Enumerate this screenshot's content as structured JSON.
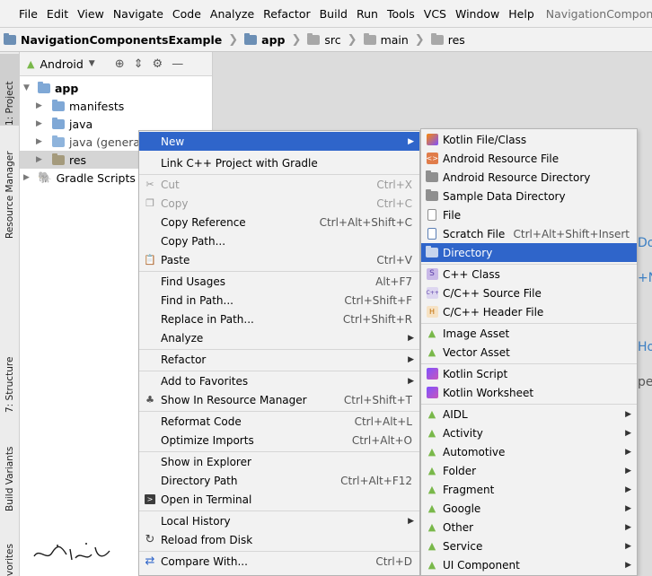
{
  "menubar": {
    "items": [
      "File",
      "Edit",
      "View",
      "Navigate",
      "Code",
      "Analyze",
      "Refactor",
      "Build",
      "Run",
      "Tools",
      "VCS",
      "Window",
      "Help"
    ],
    "project_title": "NavigationComponentsExample"
  },
  "breadcrumb": [
    "NavigationComponentsExample",
    "app",
    "src",
    "main",
    "res"
  ],
  "left_strip": {
    "tabs": [
      "1: Project",
      "Resource Manager",
      "7: Structure",
      "Build Variants",
      "vorites"
    ]
  },
  "project_panel": {
    "view_selector": "Android",
    "tree": [
      {
        "label": "app",
        "level": 0,
        "expanded": true
      },
      {
        "label": "manifests",
        "level": 1,
        "expanded": false
      },
      {
        "label": "java",
        "level": 1,
        "expanded": false
      },
      {
        "label": "java (generated)",
        "level": 1,
        "expanded": false
      },
      {
        "label": "res",
        "level": 1,
        "expanded": false,
        "selected": true
      },
      {
        "label": "Gradle Scripts",
        "level": 0,
        "expanded": false
      }
    ]
  },
  "editor": {
    "peek_texts": [
      "Do",
      "+N",
      "Ho",
      "pe"
    ]
  },
  "context_menu": {
    "items": [
      {
        "label": "New",
        "shortcut": "",
        "submenu": true,
        "highlight": true,
        "disabled": false,
        "icon": ""
      },
      {
        "label": "Link C++ Project with Gradle",
        "shortcut": "",
        "submenu": false,
        "highlight": false,
        "disabled": false,
        "icon": ""
      },
      {
        "label": "Cut",
        "shortcut": "Ctrl+X",
        "submenu": false,
        "highlight": false,
        "disabled": true,
        "icon": "cut-icon"
      },
      {
        "label": "Copy",
        "shortcut": "Ctrl+C",
        "submenu": false,
        "highlight": false,
        "disabled": true,
        "icon": "copy-icon"
      },
      {
        "label": "Copy Reference",
        "shortcut": "Ctrl+Alt+Shift+C",
        "submenu": false,
        "highlight": false,
        "disabled": false,
        "icon": ""
      },
      {
        "label": "Copy Path...",
        "shortcut": "",
        "submenu": false,
        "highlight": false,
        "disabled": false,
        "icon": ""
      },
      {
        "label": "Paste",
        "shortcut": "Ctrl+V",
        "submenu": false,
        "highlight": false,
        "disabled": false,
        "icon": "paste-icon"
      },
      {
        "label": "Find Usages",
        "shortcut": "Alt+F7",
        "submenu": false,
        "highlight": false,
        "disabled": false,
        "icon": ""
      },
      {
        "label": "Find in Path...",
        "shortcut": "Ctrl+Shift+F",
        "submenu": false,
        "highlight": false,
        "disabled": false,
        "icon": ""
      },
      {
        "label": "Replace in Path...",
        "shortcut": "Ctrl+Shift+R",
        "submenu": false,
        "highlight": false,
        "disabled": false,
        "icon": ""
      },
      {
        "label": "Analyze",
        "shortcut": "",
        "submenu": true,
        "highlight": false,
        "disabled": false,
        "icon": ""
      },
      {
        "label": "Refactor",
        "shortcut": "",
        "submenu": true,
        "highlight": false,
        "disabled": false,
        "icon": ""
      },
      {
        "label": "Add to Favorites",
        "shortcut": "",
        "submenu": true,
        "highlight": false,
        "disabled": false,
        "icon": ""
      },
      {
        "label": "Show In Resource Manager",
        "shortcut": "Ctrl+Shift+T",
        "submenu": false,
        "highlight": false,
        "disabled": false,
        "icon": "resource-manager-icon"
      },
      {
        "label": "Reformat Code",
        "shortcut": "Ctrl+Alt+L",
        "submenu": false,
        "highlight": false,
        "disabled": false,
        "icon": ""
      },
      {
        "label": "Optimize Imports",
        "shortcut": "Ctrl+Alt+O",
        "submenu": false,
        "highlight": false,
        "disabled": false,
        "icon": ""
      },
      {
        "label": "Show in Explorer",
        "shortcut": "",
        "submenu": false,
        "highlight": false,
        "disabled": false,
        "icon": ""
      },
      {
        "label": "Directory Path",
        "shortcut": "Ctrl+Alt+F12",
        "submenu": false,
        "highlight": false,
        "disabled": false,
        "icon": ""
      },
      {
        "label": "Open in Terminal",
        "shortcut": "",
        "submenu": false,
        "highlight": false,
        "disabled": false,
        "icon": "terminal-icon"
      },
      {
        "label": "Local History",
        "shortcut": "",
        "submenu": true,
        "highlight": false,
        "disabled": false,
        "icon": ""
      },
      {
        "label": "Reload from Disk",
        "shortcut": "",
        "submenu": false,
        "highlight": false,
        "disabled": false,
        "icon": "reload-icon"
      },
      {
        "label": "Compare With...",
        "shortcut": "Ctrl+D",
        "submenu": false,
        "highlight": false,
        "disabled": false,
        "icon": "compare-icon"
      }
    ]
  },
  "submenu": {
    "items": [
      {
        "label": "Kotlin File/Class",
        "shortcut": "",
        "submenu": false,
        "highlight": false,
        "icon": "kotlin-file-icon"
      },
      {
        "label": "Android Resource File",
        "shortcut": "",
        "submenu": false,
        "highlight": false,
        "icon": "android-resource-file-icon"
      },
      {
        "label": "Android Resource Directory",
        "shortcut": "",
        "submenu": false,
        "highlight": false,
        "icon": "folder-icon"
      },
      {
        "label": "Sample Data Directory",
        "shortcut": "",
        "submenu": false,
        "highlight": false,
        "icon": "folder-icon"
      },
      {
        "label": "File",
        "shortcut": "",
        "submenu": false,
        "highlight": false,
        "icon": "file-icon"
      },
      {
        "label": "Scratch File",
        "shortcut": "Ctrl+Alt+Shift+Insert",
        "submenu": false,
        "highlight": false,
        "icon": "scratch-file-icon"
      },
      {
        "label": "Directory",
        "shortcut": "",
        "submenu": false,
        "highlight": true,
        "icon": "folder-icon"
      },
      {
        "label": "C++ Class",
        "shortcut": "",
        "submenu": false,
        "highlight": false,
        "icon": "cpp-class-icon"
      },
      {
        "label": "C/C++ Source File",
        "shortcut": "",
        "submenu": false,
        "highlight": false,
        "icon": "cpp-source-icon"
      },
      {
        "label": "C/C++ Header File",
        "shortcut": "",
        "submenu": false,
        "highlight": false,
        "icon": "cpp-header-icon"
      },
      {
        "label": "Image Asset",
        "shortcut": "",
        "submenu": false,
        "highlight": false,
        "icon": "android-icon"
      },
      {
        "label": "Vector Asset",
        "shortcut": "",
        "submenu": false,
        "highlight": false,
        "icon": "android-icon"
      },
      {
        "label": "Kotlin Script",
        "shortcut": "",
        "submenu": false,
        "highlight": false,
        "icon": "kotlin-script-icon"
      },
      {
        "label": "Kotlin Worksheet",
        "shortcut": "",
        "submenu": false,
        "highlight": false,
        "icon": "kotlin-worksheet-icon"
      },
      {
        "label": "AIDL",
        "shortcut": "",
        "submenu": true,
        "highlight": false,
        "icon": "android-icon"
      },
      {
        "label": "Activity",
        "shortcut": "",
        "submenu": true,
        "highlight": false,
        "icon": "android-icon"
      },
      {
        "label": "Automotive",
        "shortcut": "",
        "submenu": true,
        "highlight": false,
        "icon": "android-icon"
      },
      {
        "label": "Folder",
        "shortcut": "",
        "submenu": true,
        "highlight": false,
        "icon": "android-icon"
      },
      {
        "label": "Fragment",
        "shortcut": "",
        "submenu": true,
        "highlight": false,
        "icon": "android-icon"
      },
      {
        "label": "Google",
        "shortcut": "",
        "submenu": true,
        "highlight": false,
        "icon": "android-icon"
      },
      {
        "label": "Other",
        "shortcut": "",
        "submenu": true,
        "highlight": false,
        "icon": "android-icon"
      },
      {
        "label": "Service",
        "shortcut": "",
        "submenu": true,
        "highlight": false,
        "icon": "android-icon"
      },
      {
        "label": "UI Component",
        "shortcut": "",
        "submenu": true,
        "highlight": false,
        "icon": "android-icon"
      }
    ]
  },
  "colors": {
    "highlight": "#2f65ca",
    "folder": "#7fa8d6",
    "android_green": "#79b84a",
    "kotlin": "#8a5bd6"
  }
}
